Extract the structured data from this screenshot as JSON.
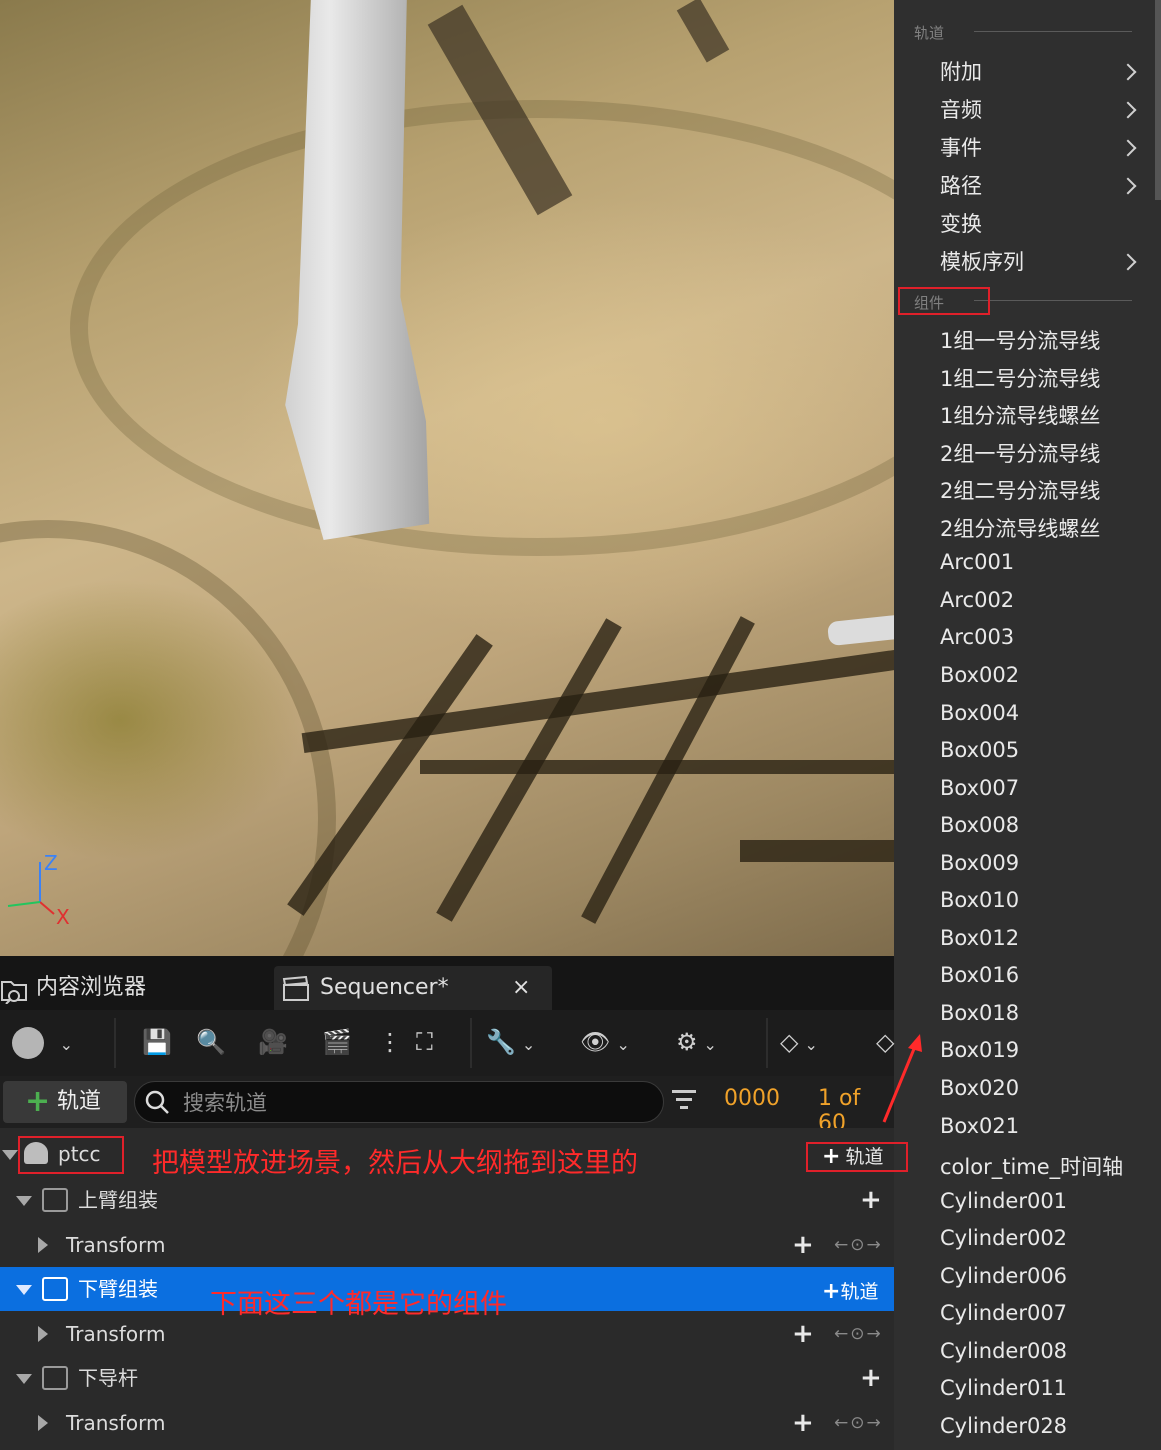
{
  "menu": {
    "section_tracks": "轨道",
    "tracks": [
      {
        "label": "附加",
        "submenu": true
      },
      {
        "label": "音频",
        "submenu": true
      },
      {
        "label": "事件",
        "submenu": true
      },
      {
        "label": "路径",
        "submenu": true
      },
      {
        "label": "变换",
        "submenu": false
      },
      {
        "label": "模板序列",
        "submenu": true
      }
    ],
    "section_components": "组件",
    "components": [
      "1组一号分流导线",
      "1组二号分流导线",
      "1组分流导线螺丝",
      "2组一号分流导线",
      "2组二号分流导线",
      "2组分流导线螺丝",
      "Arc001",
      "Arc002",
      "Arc003",
      "Box002",
      "Box004",
      "Box005",
      "Box007",
      "Box008",
      "Box009",
      "Box010",
      "Box012",
      "Box016",
      "Box018",
      "Box019",
      "Box020",
      "Box021",
      "color_time_时间轴",
      "Cylinder001",
      "Cylinder002",
      "Cylinder006",
      "Cylinder007",
      "Cylinder008",
      "Cylinder011",
      "Cylinder028"
    ]
  },
  "viewport": {
    "axis_z": "Z",
    "axis_x": "X"
  },
  "tabs": [
    {
      "label": "内容浏览器",
      "icon": "folder-search-icon"
    },
    {
      "label": "Sequencer*",
      "icon": "clapperboard-icon",
      "close": "×"
    }
  ],
  "filterbar": {
    "add_track_label": "轨道",
    "search_placeholder": "搜索轨道",
    "frame": "0000",
    "page": "1 of 60"
  },
  "tree": {
    "actor": "ptcc",
    "actor_add_label": "轨道",
    "rows": [
      {
        "label": "上臂组装",
        "type": "component"
      },
      {
        "label": "Transform",
        "type": "track"
      },
      {
        "label": "下臂组装",
        "type": "component",
        "selected": true,
        "add_label": "轨道"
      },
      {
        "label": "Transform",
        "type": "track"
      },
      {
        "label": "下导杆",
        "type": "component"
      },
      {
        "label": "Transform",
        "type": "track"
      }
    ]
  },
  "annotations": {
    "note1": "把模型放进场景，然后从大纲拖到这里的",
    "note2": "下面这三个都是它的组件"
  },
  "colors": {
    "selected_row": "#0b6fe0",
    "accent_orange": "#f0a22a",
    "annotation_red": "#ff2a2a"
  }
}
